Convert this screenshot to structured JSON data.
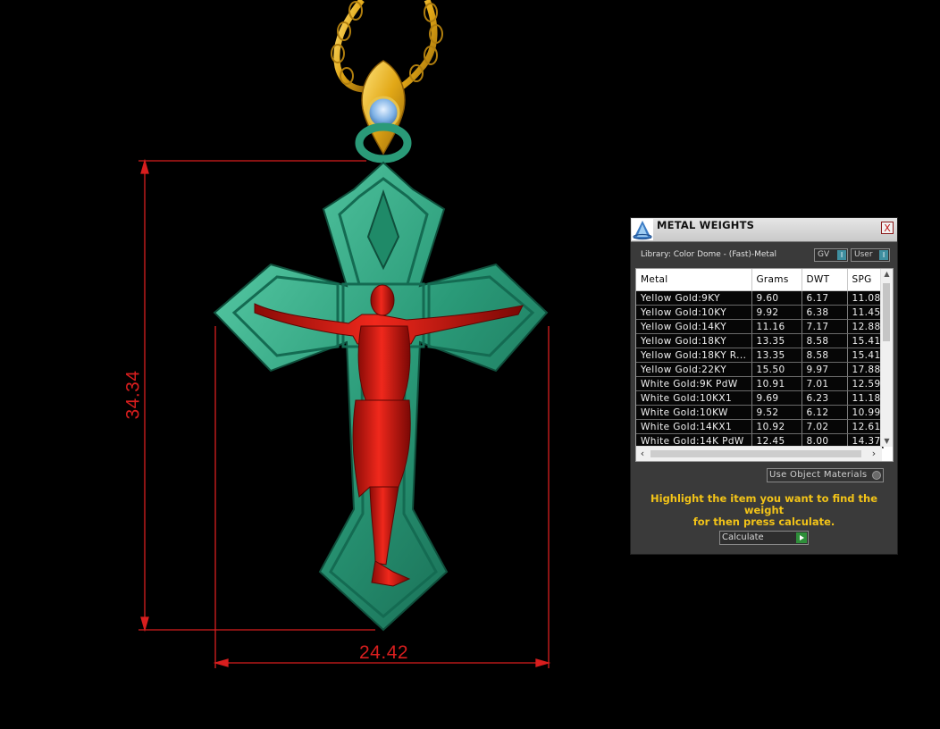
{
  "viewport": {
    "dimension_height": "34.34",
    "dimension_width": "24.42"
  },
  "panel": {
    "title": "METAL WEIGHTS",
    "close_label": "X",
    "library_label": "Library: Color Dome - (Fast)-Metal",
    "toggle_gv": "GV",
    "toggle_user": "User",
    "toggle_indicator": "I",
    "columns": [
      "Metal",
      "Grams",
      "DWT",
      "SPG"
    ],
    "rows": [
      [
        "Yellow Gold:9KY",
        "9.60",
        "6.17",
        "11.08"
      ],
      [
        "Yellow Gold:10KY",
        "9.92",
        "6.38",
        "11.45"
      ],
      [
        "Yellow Gold:14KY",
        "11.16",
        "7.17",
        "12.88"
      ],
      [
        "Yellow Gold:18KY",
        "13.35",
        "8.58",
        "15.41"
      ],
      [
        "Yellow Gold:18KY R...",
        "13.35",
        "8.58",
        "15.41"
      ],
      [
        "Yellow Gold:22KY",
        "15.50",
        "9.97",
        "17.88"
      ],
      [
        "White Gold:9K PdW",
        "10.91",
        "7.01",
        "12.59"
      ],
      [
        "White Gold:10KX1",
        "9.69",
        "6.23",
        "11.18"
      ],
      [
        "White Gold:10KW",
        "9.52",
        "6.12",
        "10.99"
      ],
      [
        "White Gold:14KX1",
        "10.92",
        "7.02",
        "12.61"
      ],
      [
        "White Gold:14K PdW",
        "12.45",
        "8.00",
        "14.37"
      ]
    ],
    "use_materials_label": "Use Object Materials",
    "instructions_line1": "Highlight the item you want to find the weight",
    "instructions_line2": "for then press calculate.",
    "calculate_label": "Calculate"
  },
  "colors": {
    "dimension": "#d81e1e",
    "pendant": "#2a9a78",
    "figure": "#d4140f",
    "gold": "#e2a817",
    "gem": "#7fb2e6",
    "instructions": "#f2c318"
  }
}
